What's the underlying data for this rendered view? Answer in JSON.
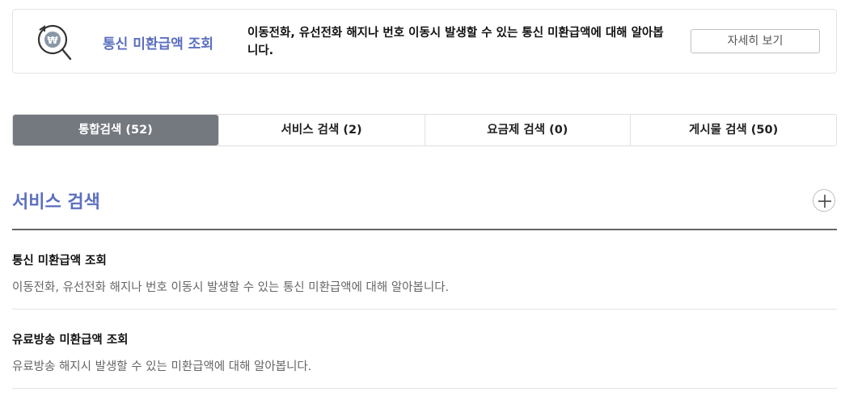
{
  "banner": {
    "icon": "won-magnifier-icon",
    "title": "통신 미환급액 조회",
    "description": "이동전화, 유선전화 해지나 번호 이동시 발생할 수 있는 통신 미환급액에 대해 알아봅니다.",
    "button_label": "자세히 보기",
    "accent_color": "#5b6fbf"
  },
  "tabs": [
    {
      "label": "통합검색 (52)",
      "active": true
    },
    {
      "label": "서비스 검색 (2)",
      "active": false
    },
    {
      "label": "요금제 검색 (0)",
      "active": false
    },
    {
      "label": "게시물 검색 (50)",
      "active": false
    }
  ],
  "section": {
    "title": "서비스 검색",
    "expand_icon": "plus-icon",
    "results": [
      {
        "title": "통신 미환급액 조회",
        "description": "이동전화, 유선전화 해지나 번호 이동시 발생할 수 있는 통신 미환급액에 대해 알아봅니다."
      },
      {
        "title": "유료방송 미환급액 조회",
        "description": "유료방송 해지시 발생할 수 있는 미환급액에 대해 알아봅니다."
      }
    ]
  }
}
